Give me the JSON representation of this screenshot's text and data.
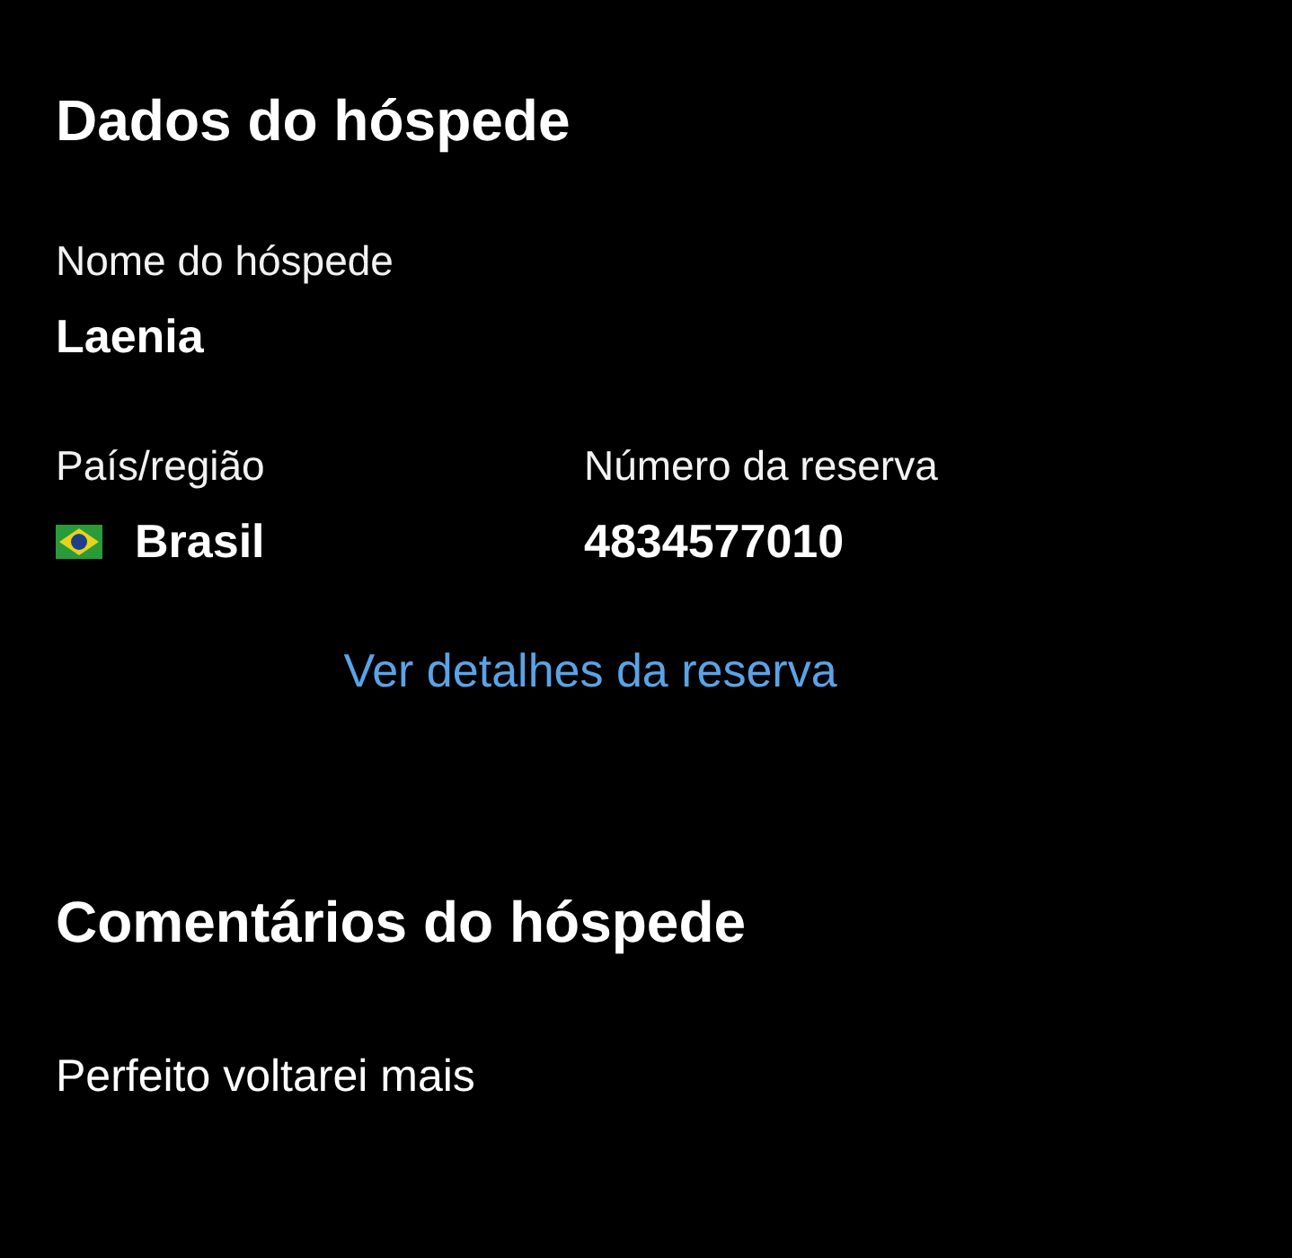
{
  "guest_section": {
    "title": "Dados do hóspede",
    "name_label": "Nome do hóspede",
    "name": "Laenia",
    "country_label": "País/região",
    "country": "Brasil",
    "booking_label": "Número da reserva",
    "booking_number": "4834577010",
    "details_link": "Ver detalhes da reserva"
  },
  "comments_section": {
    "title": "Comentários do hóspede",
    "comment": "Perfeito voltarei mais"
  }
}
